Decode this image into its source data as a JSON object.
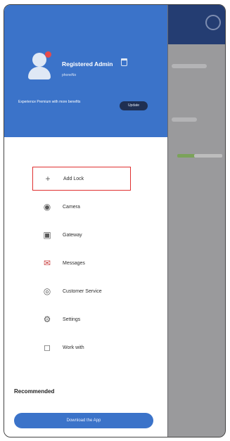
{
  "header": {
    "username": "Registered Admin",
    "phone": "phoneNo",
    "promo_text": "Experience Premium with more benefits",
    "upgrade_label": "Update"
  },
  "menu": {
    "items": [
      {
        "label": "Add Lock",
        "icon": "plus-icon"
      },
      {
        "label": "Camera",
        "icon": "camera-icon"
      },
      {
        "label": "Gateway",
        "icon": "gateway-icon"
      },
      {
        "label": "Messages",
        "icon": "message-icon"
      },
      {
        "label": "Customer Service",
        "icon": "headset-icon"
      },
      {
        "label": "Settings",
        "icon": "gear-icon"
      },
      {
        "label": "Work with",
        "icon": "link-icon"
      }
    ]
  },
  "recommended": {
    "title": "Recommended",
    "button_label": "Download the App"
  },
  "colors": {
    "header_bg": "#3b73c9",
    "highlight": "#e03030"
  }
}
